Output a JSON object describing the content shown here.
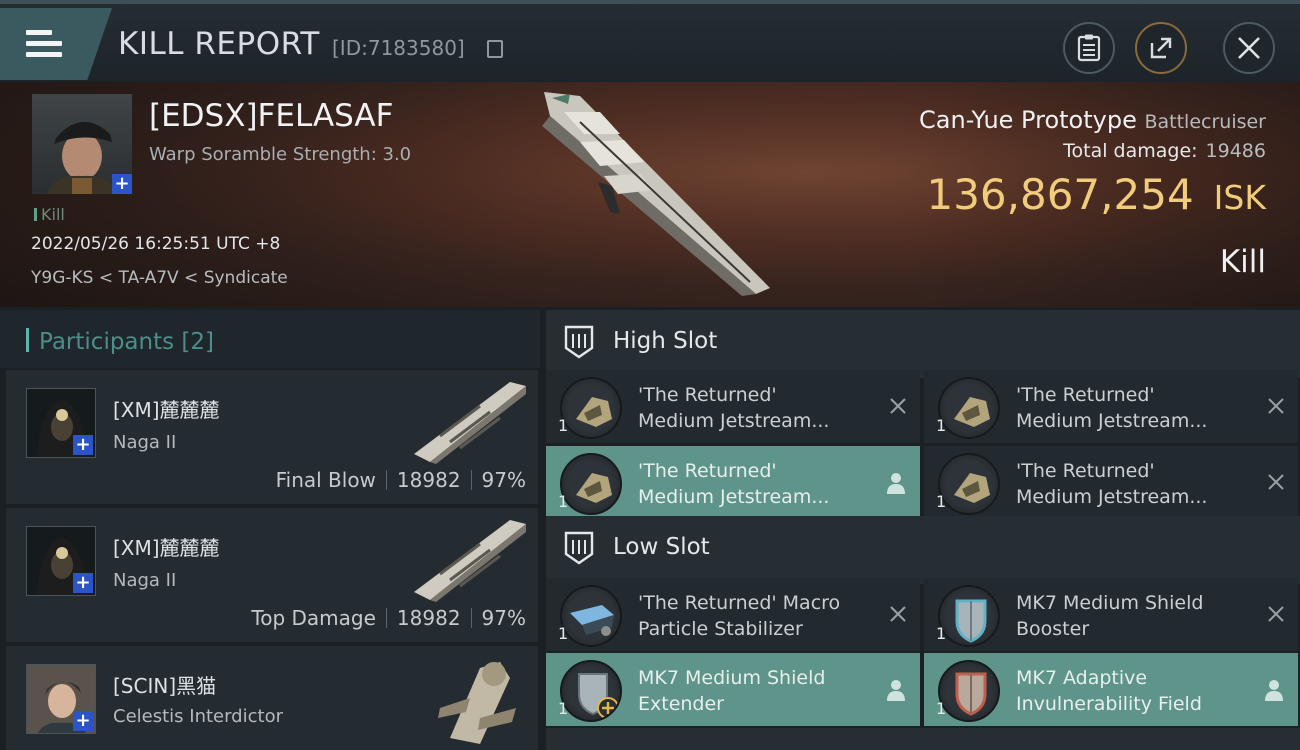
{
  "header": {
    "title": "KILL REPORT",
    "report_id": "[ID:7183580]",
    "menu_icon": "hamburger-menu-icon",
    "buttons": [
      "clipboard-icon",
      "share-icon",
      "close-icon"
    ]
  },
  "victim": {
    "name": "[EDSX]FELASAF",
    "subtitle": "Warp Soramble Strength: 3.0",
    "tag": "Kill",
    "datetime": "2022/05/26 16:25:51 UTC +8",
    "location": "Y9G-KS < TA-A7V < Syndicate",
    "ship_name": "Can-Yue Prototype",
    "ship_class": "Battlecruiser",
    "total_damage_label": "Total damage:",
    "total_damage_value": "19486",
    "isk_value": "136,867,254",
    "isk_unit": "ISK",
    "result": "Kill"
  },
  "participants": {
    "title": "Participants [2]",
    "items": [
      {
        "name": "[XM]麓麓麓",
        "ship": "Naga II",
        "role": "Final Blow",
        "damage": "18982",
        "percent": "97%"
      },
      {
        "name": "[XM]麓麓麓",
        "ship": "Naga II",
        "role": "Top Damage",
        "damage": "18982",
        "percent": "97%"
      },
      {
        "name": "[SCIN]黑猫",
        "ship": "Celestis Interdictor"
      }
    ]
  },
  "slots": {
    "high": {
      "title": "High Slot",
      "modules": [
        {
          "line1": "'The Returned'",
          "line2": "Medium Jetstream...",
          "qty": "1",
          "state": "dropped"
        },
        {
          "line1": "'The Returned'",
          "line2": "Medium Jetstream...",
          "qty": "1",
          "state": "dropped"
        },
        {
          "line1": "'The Returned'",
          "line2": "Medium Jetstream...",
          "qty": "1",
          "state": "fitted"
        },
        {
          "line1": "'The Returned'",
          "line2": "Medium Jetstream...",
          "qty": "1",
          "state": "dropped"
        }
      ]
    },
    "low": {
      "title": "Low Slot",
      "modules": [
        {
          "line1": "'The Returned' Macro",
          "line2": "Particle Stabilizer",
          "qty": "1",
          "state": "dropped"
        },
        {
          "line1": "MK7 Medium Shield",
          "line2": "Booster",
          "qty": "1",
          "state": "dropped"
        },
        {
          "line1": "MK7 Medium Shield",
          "line2": "Extender",
          "qty": "1",
          "state": "fitted"
        },
        {
          "line1": "MK7 Adaptive",
          "line2": "Invulnerability Field",
          "qty": "1",
          "state": "fitted"
        }
      ]
    }
  },
  "colors": {
    "accent_teal": "#5e9489",
    "isk_gold": "#f1cc7a",
    "badge_blue": "#2b54c8"
  }
}
